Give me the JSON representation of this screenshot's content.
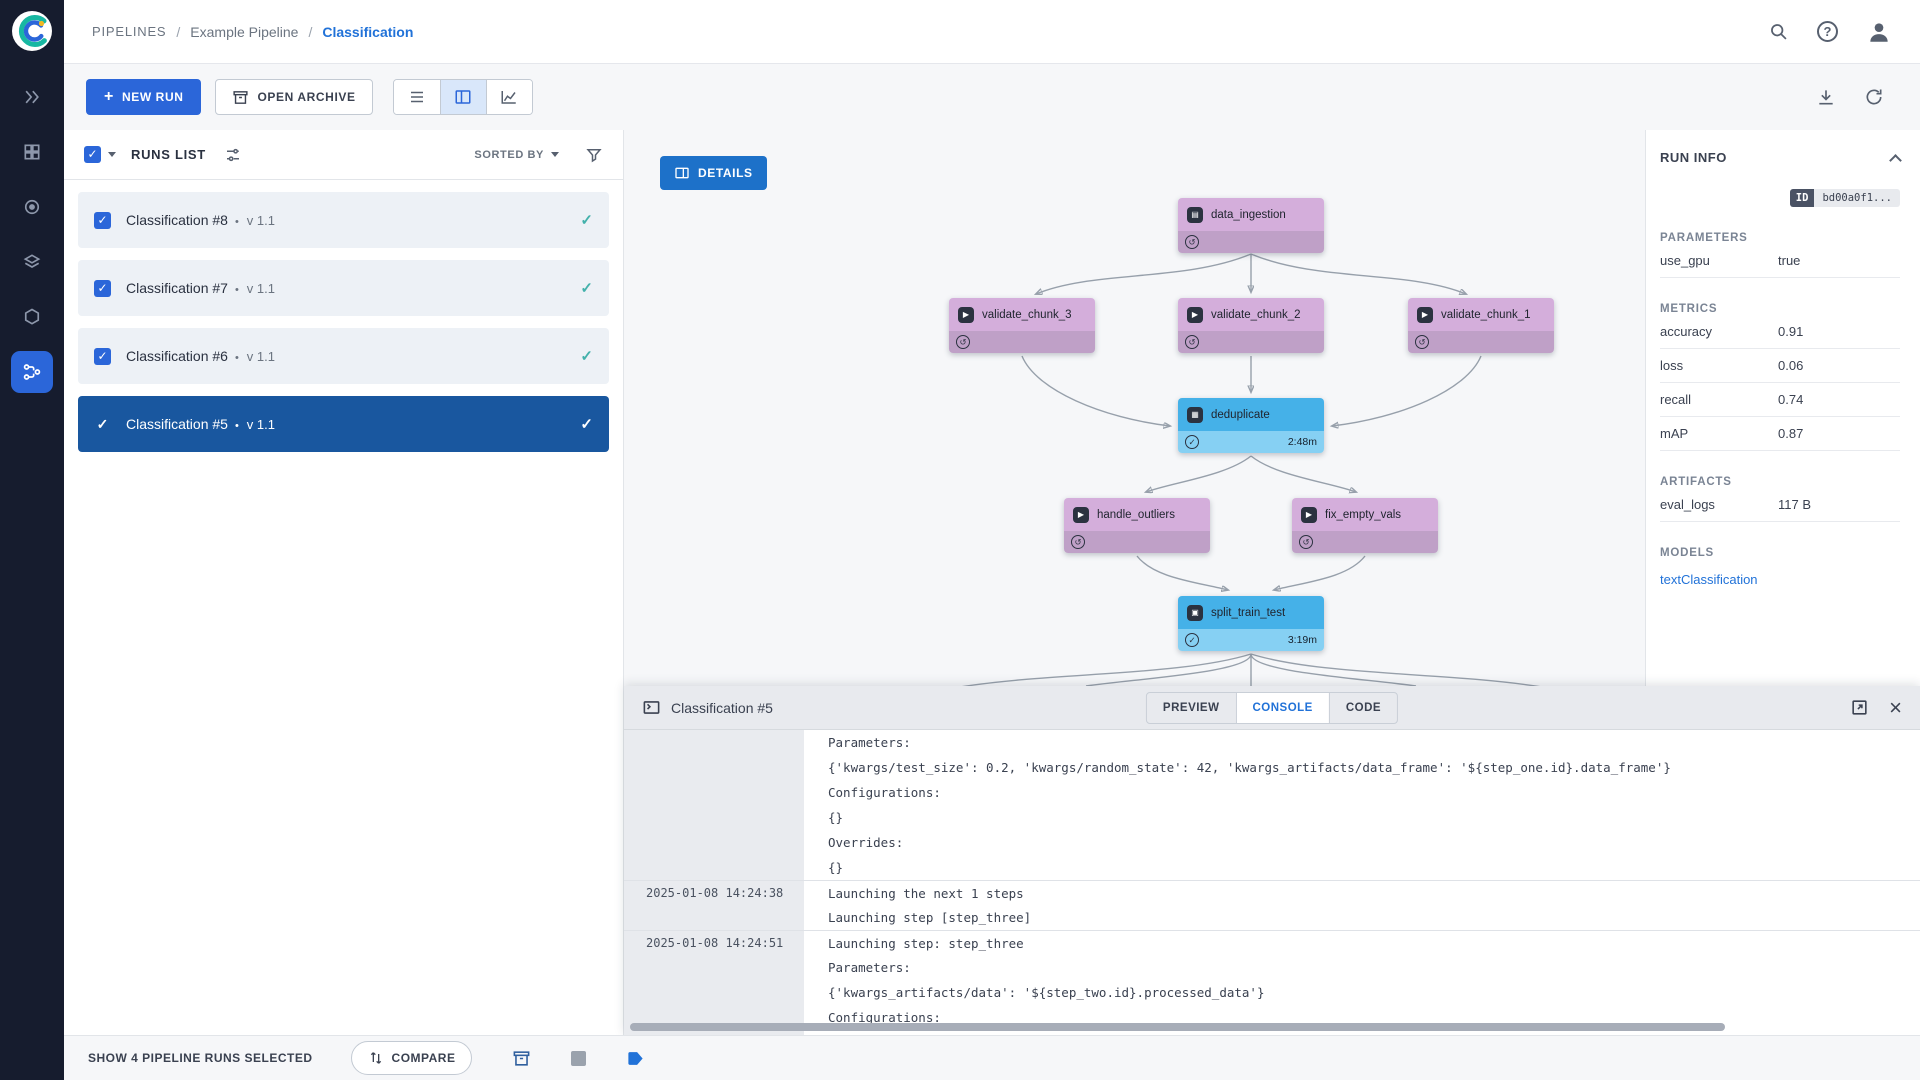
{
  "app": {
    "accent": "#2b66d9",
    "breadcrumb": {
      "root": "PIPELINES",
      "sep": "/",
      "project": "Example Pipeline",
      "page": "Classification"
    }
  },
  "glyphs": {
    "check": "✓",
    "help": "?",
    "close": "×",
    "plus": "+",
    "cached": "↺"
  },
  "toolbar": {
    "new_run": "NEW RUN",
    "open_archive": "OPEN ARCHIVE"
  },
  "runs_panel": {
    "title": "RUNS LIST",
    "sorted_by_label": "SORTED BY",
    "runs": [
      {
        "name": "Classification #8",
        "version": "v 1.1"
      },
      {
        "name": "Classification #7",
        "version": "v 1.1"
      },
      {
        "name": "Classification #6",
        "version": "v 1.1"
      },
      {
        "name": "Classification #5",
        "version": "v 1.1"
      }
    ]
  },
  "graph": {
    "details_button": "DETAILS",
    "nodes": [
      {
        "id": "data_ingestion",
        "label": "data_ingestion",
        "glyph": "▤",
        "status": "cached"
      },
      {
        "id": "validate_chunk_3",
        "label": "validate_chunk_3",
        "glyph": "▶",
        "status": "cached"
      },
      {
        "id": "validate_chunk_2",
        "label": "validate_chunk_2",
        "glyph": "▶",
        "status": "cached"
      },
      {
        "id": "validate_chunk_1",
        "label": "validate_chunk_1",
        "glyph": "▶",
        "status": "cached"
      },
      {
        "id": "deduplicate",
        "label": "deduplicate",
        "glyph": "▦",
        "status": "completed",
        "duration": "2:48m"
      },
      {
        "id": "handle_outliers",
        "label": "handle_outliers",
        "glyph": "▶",
        "status": "cached"
      },
      {
        "id": "fix_empty_vals",
        "label": "fix_empty_vals",
        "glyph": "▶",
        "status": "cached"
      },
      {
        "id": "split_train_test",
        "label": "split_train_test",
        "glyph": "▣",
        "status": "completed",
        "duration": "3:19m"
      }
    ]
  },
  "run_info": {
    "title": "RUN INFO",
    "id_label": "ID",
    "id_value": "bd00a0f1...",
    "sections": {
      "parameters": {
        "title": "PARAMETERS",
        "rows": [
          {
            "key": "use_gpu",
            "value": "true"
          }
        ]
      },
      "metrics": {
        "title": "METRICS",
        "rows": [
          {
            "key": "accuracy",
            "value": "0.91"
          },
          {
            "key": "loss",
            "value": "0.06"
          },
          {
            "key": "recall",
            "value": "0.74"
          },
          {
            "key": "mAP",
            "value": "0.87"
          }
        ]
      },
      "artifacts": {
        "title": "ARTIFACTS",
        "rows": [
          {
            "key": "eval_logs",
            "value": "117 B"
          }
        ]
      },
      "models": {
        "title": "MODELS",
        "link": "textClassification"
      }
    }
  },
  "console": {
    "title": "Classification #5",
    "tabs": [
      {
        "label": "PREVIEW"
      },
      {
        "label": "CONSOLE"
      },
      {
        "label": "CODE"
      }
    ],
    "active_tab": "CONSOLE",
    "lines": [
      {
        "time": "",
        "text": "Parameters:"
      },
      {
        "time": "",
        "text": "{'kwargs/test_size': 0.2, 'kwargs/random_state': 42, 'kwargs_artifacts/data_frame': '${step_one.id}.data_frame'}"
      },
      {
        "time": "",
        "text": "Configurations:"
      },
      {
        "time": "",
        "text": "{}"
      },
      {
        "time": "",
        "text": "Overrides:"
      },
      {
        "time": "",
        "text": "{}"
      },
      {
        "time": "2025-01-08 14:24:38",
        "text": "Launching the next 1 steps"
      },
      {
        "time": "",
        "text": "Launching step [step_three]"
      },
      {
        "time": "2025-01-08 14:24:51",
        "text": "Launching step: step_three"
      },
      {
        "time": "",
        "text": "Parameters:"
      },
      {
        "time": "",
        "text": "{'kwargs_artifacts/data': '${step_two.id}.processed_data'}"
      },
      {
        "time": "",
        "text": "Configurations:"
      }
    ]
  },
  "footer": {
    "selection_text": "SHOW 4 PIPELINE RUNS SELECTED",
    "compare": "COMPARE"
  }
}
